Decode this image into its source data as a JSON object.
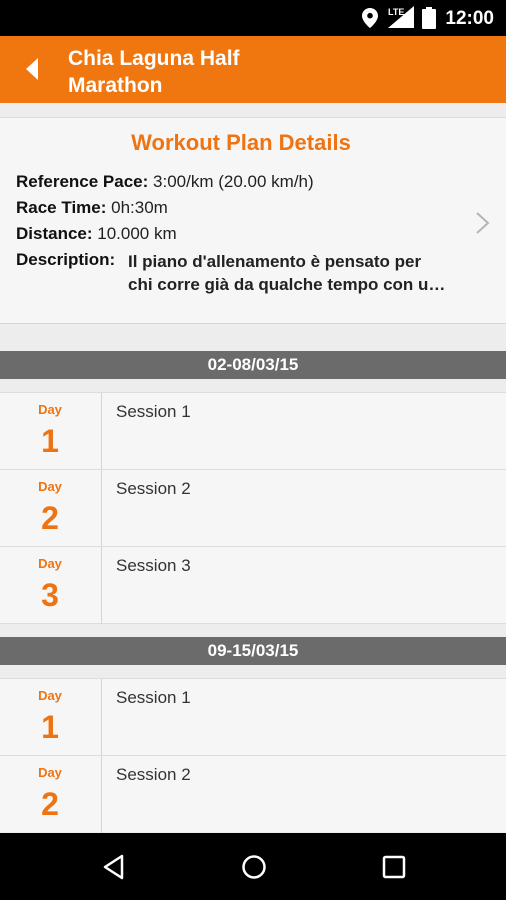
{
  "status_bar": {
    "time": "12:00",
    "network": "LTE",
    "icons": [
      "location-icon",
      "signal-icon",
      "battery-icon"
    ]
  },
  "app_bar": {
    "title_line1": "Chia Laguna Half",
    "title_line2": "Marathon",
    "back_icon": "back-arrow-icon",
    "color": "#f07610"
  },
  "plan": {
    "title": "Workout Plan Details",
    "reference_pace_label": "Reference Pace:",
    "reference_pace_value": "3:00/km (20.00 km/h)",
    "race_time_label": "Race Time:",
    "race_time_value": "0h:30m",
    "distance_label": "Distance:",
    "distance_value": "10.000 km",
    "description_label": "Description:",
    "description_line1": "Il piano d'allenamento è pensato per",
    "description_line2": "chi corre già da qualche tempo con u…",
    "accent_color": "#ee7413"
  },
  "weeks": [
    {
      "header": "02-08/03/15",
      "days": [
        {
          "label": "Day",
          "number": "1",
          "session": "Session 1"
        },
        {
          "label": "Day",
          "number": "2",
          "session": "Session 2"
        },
        {
          "label": "Day",
          "number": "3",
          "session": "Session 3"
        }
      ]
    },
    {
      "header": "09-15/03/15",
      "days": [
        {
          "label": "Day",
          "number": "1",
          "session": "Session 1"
        },
        {
          "label": "Day",
          "number": "2",
          "session": "Session 2"
        }
      ]
    }
  ],
  "nav_bar": {
    "icons": [
      "back-triangle-icon",
      "home-circle-icon",
      "recents-square-icon"
    ]
  }
}
